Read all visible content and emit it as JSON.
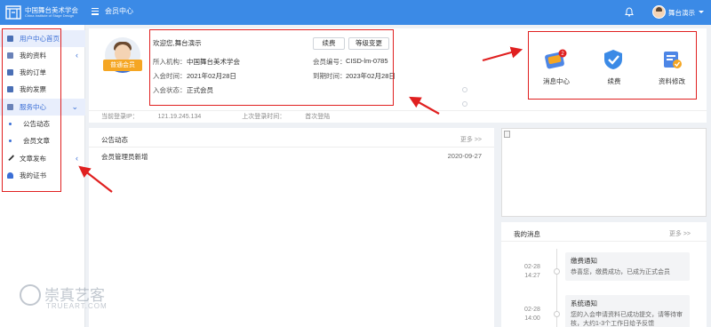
{
  "header": {
    "logo_text": "中国舞台美术学会",
    "logo_sub": "China Institute of Stage Design",
    "current_tab": "会员中心",
    "user_name": "舞台演示"
  },
  "sidebar": {
    "items": [
      {
        "label": "用户中心首页"
      },
      {
        "label": "我的资料"
      },
      {
        "label": "我的订单"
      },
      {
        "label": "我的发票"
      },
      {
        "label": "服务中心"
      },
      {
        "label": "公告动态"
      },
      {
        "label": "会员文章"
      },
      {
        "label": "文章发布"
      },
      {
        "label": "我的证书"
      }
    ]
  },
  "profile": {
    "greeting": "欢迎您,舞台演示",
    "member_type": "普通会员",
    "org_label": "所入机构：",
    "org_value": "中国舞台美术学会",
    "join_label": "入会时间：",
    "join_value": "2021年02月28日",
    "status_label": "入会状态：",
    "status_value": "正式会员",
    "number_label": "会员编号：",
    "number_value": "CISD-lm-0785",
    "expire_label": "到期时间：",
    "expire_value": "2023年02月28日",
    "renew_button": "续费",
    "upgrade_button": "等级变更",
    "current_ip_label": "当前登录IP：",
    "current_ip": "121.19.245.134",
    "last_login_label": "上次登录时间：",
    "last_login": "首次登陆"
  },
  "shortcuts": [
    {
      "label": "消息中心",
      "icon": "message-center-icon",
      "badge": "2"
    },
    {
      "label": "续费",
      "icon": "renew-icon"
    },
    {
      "label": "资料修改",
      "icon": "edit-profile-icon"
    }
  ],
  "notices": {
    "title": "公告动态",
    "more": "更多 >>",
    "rows": [
      {
        "title": "会员管理员新增",
        "date": "2020-09-27"
      }
    ]
  },
  "messages": {
    "title": "我的消息",
    "more": "更多 >>",
    "items": [
      {
        "date": "02-28",
        "time": "14:27",
        "title": "缴费通知",
        "body": "恭喜您，缴费成功，已成为正式会员"
      },
      {
        "date": "02-28",
        "time": "14:00",
        "title": "系统通知",
        "body": "您的入会申请资料已成功提交，请等待审核，大约1-3个工作日给予反馈"
      }
    ]
  },
  "watermark": {
    "cn": "崇真艺客",
    "en": "TRUEART.COM"
  },
  "colors": {
    "topbar": "#3b8ae6",
    "accent": "#3b6fd6",
    "highlight": "#e02020",
    "member_tag": "#f5a623"
  }
}
